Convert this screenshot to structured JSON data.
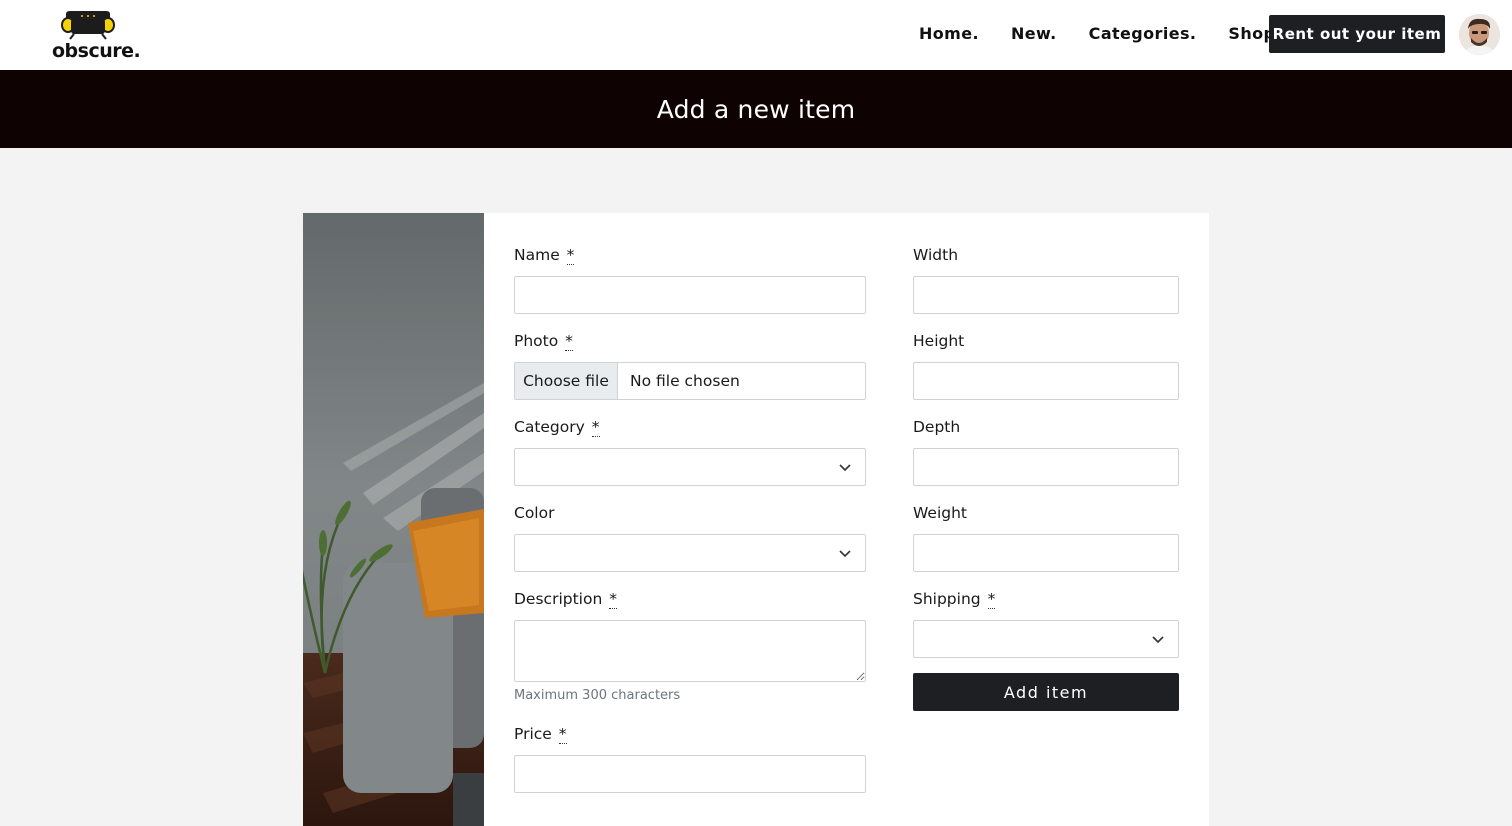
{
  "brand": {
    "name": "obscure."
  },
  "nav": {
    "links": [
      "Home.",
      "New.",
      "Categories.",
      "Shop."
    ],
    "cta": "Rent out your item"
  },
  "banner": {
    "title": "Add a new item"
  },
  "form": {
    "required_marker": "*",
    "name": {
      "label": "Name",
      "value": ""
    },
    "photo": {
      "label": "Photo",
      "button": "Choose file",
      "status": "No file chosen"
    },
    "category": {
      "label": "Category",
      "selected": ""
    },
    "color": {
      "label": "Color",
      "selected": ""
    },
    "description": {
      "label": "Description",
      "value": "",
      "help": "Maximum 300 characters"
    },
    "price": {
      "label": "Price",
      "value": ""
    },
    "width": {
      "label": "Width",
      "value": ""
    },
    "height": {
      "label": "Height",
      "value": ""
    },
    "depth": {
      "label": "Depth",
      "value": ""
    },
    "weight": {
      "label": "Weight",
      "value": ""
    },
    "shipping": {
      "label": "Shipping",
      "selected": ""
    },
    "submit": "Add item"
  },
  "colors": {
    "navbar_bg": "#ffffff",
    "banner_bg": "#0f0203",
    "button_bg": "#1d1f23",
    "page_bg": "#f3f3f3",
    "logo_accent": "#f5d10a"
  },
  "icons": [
    "sofa-logo-icon",
    "chevron-down-icon",
    "user-avatar"
  ]
}
